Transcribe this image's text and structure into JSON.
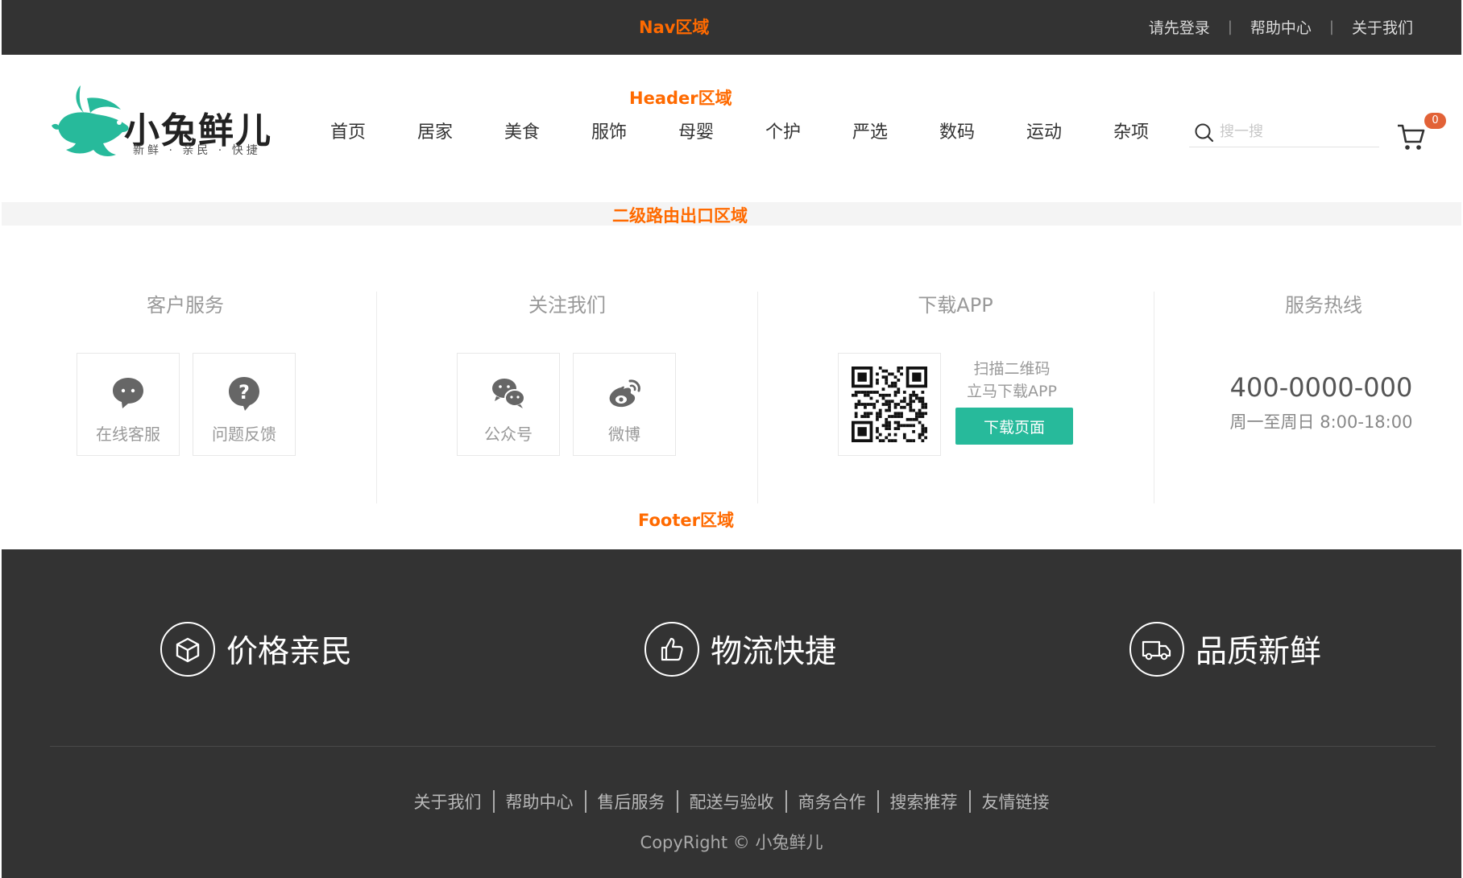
{
  "nav": {
    "zone_label": "Nav区域",
    "links": [
      "请先登录",
      "帮助中心",
      "关于我们"
    ]
  },
  "header": {
    "zone_label": "Header区域",
    "logo_text": "小兔鲜儿",
    "logo_subtitle": "新鲜 · 亲民 · 快捷",
    "menu": [
      "首页",
      "居家",
      "美食",
      "服饰",
      "母婴",
      "个护",
      "严选",
      "数码",
      "运动",
      "杂项"
    ],
    "search_placeholder": "搜一搜",
    "cart_count": "0"
  },
  "router": {
    "zone_label": "二级路由出口区域"
  },
  "service": {
    "columns": [
      "客户服务",
      "关注我们",
      "下载APP",
      "服务热线"
    ],
    "customer": {
      "online": "在线客服",
      "feedback": "问题反馈"
    },
    "follow": {
      "wechat": "公众号",
      "weibo": "微博"
    },
    "app": {
      "scan_line1": "扫描二维码",
      "scan_line2": "立马下载APP",
      "button": "下载页面"
    },
    "hotline": {
      "phone": "400-0000-000",
      "hours": "周一至周日 8:00-18:00"
    },
    "zone_label": "Footer区域"
  },
  "footer": {
    "features": [
      "价格亲民",
      "物流快捷",
      "品质新鲜"
    ],
    "links": [
      "关于我们",
      "帮助中心",
      "售后服务",
      "配送与验收",
      "商务合作",
      "搜索推荐",
      "友情链接"
    ],
    "copyright": "CopyRight © 小兔鲜儿"
  },
  "colors": {
    "brand": "#27ba9b",
    "nav_bg": "#333333",
    "zone_label": "#ff6a00",
    "badge": "#e26237"
  }
}
